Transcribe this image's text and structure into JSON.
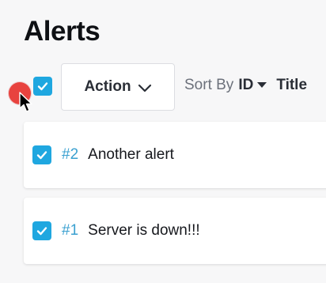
{
  "page": {
    "title": "Alerts"
  },
  "toolbar": {
    "action_label": "Action",
    "sort_label": "Sort By",
    "sort_field": "ID",
    "sort_next_option": "Title"
  },
  "alerts": [
    {
      "id": "#2",
      "title": "Another alert",
      "checked": true
    },
    {
      "id": "#1",
      "title": "Server is down!!!",
      "checked": true
    }
  ],
  "colors": {
    "accent": "#1fa7e0",
    "id_link": "#3aa0d0",
    "cursor_dot": "#e8433f"
  }
}
